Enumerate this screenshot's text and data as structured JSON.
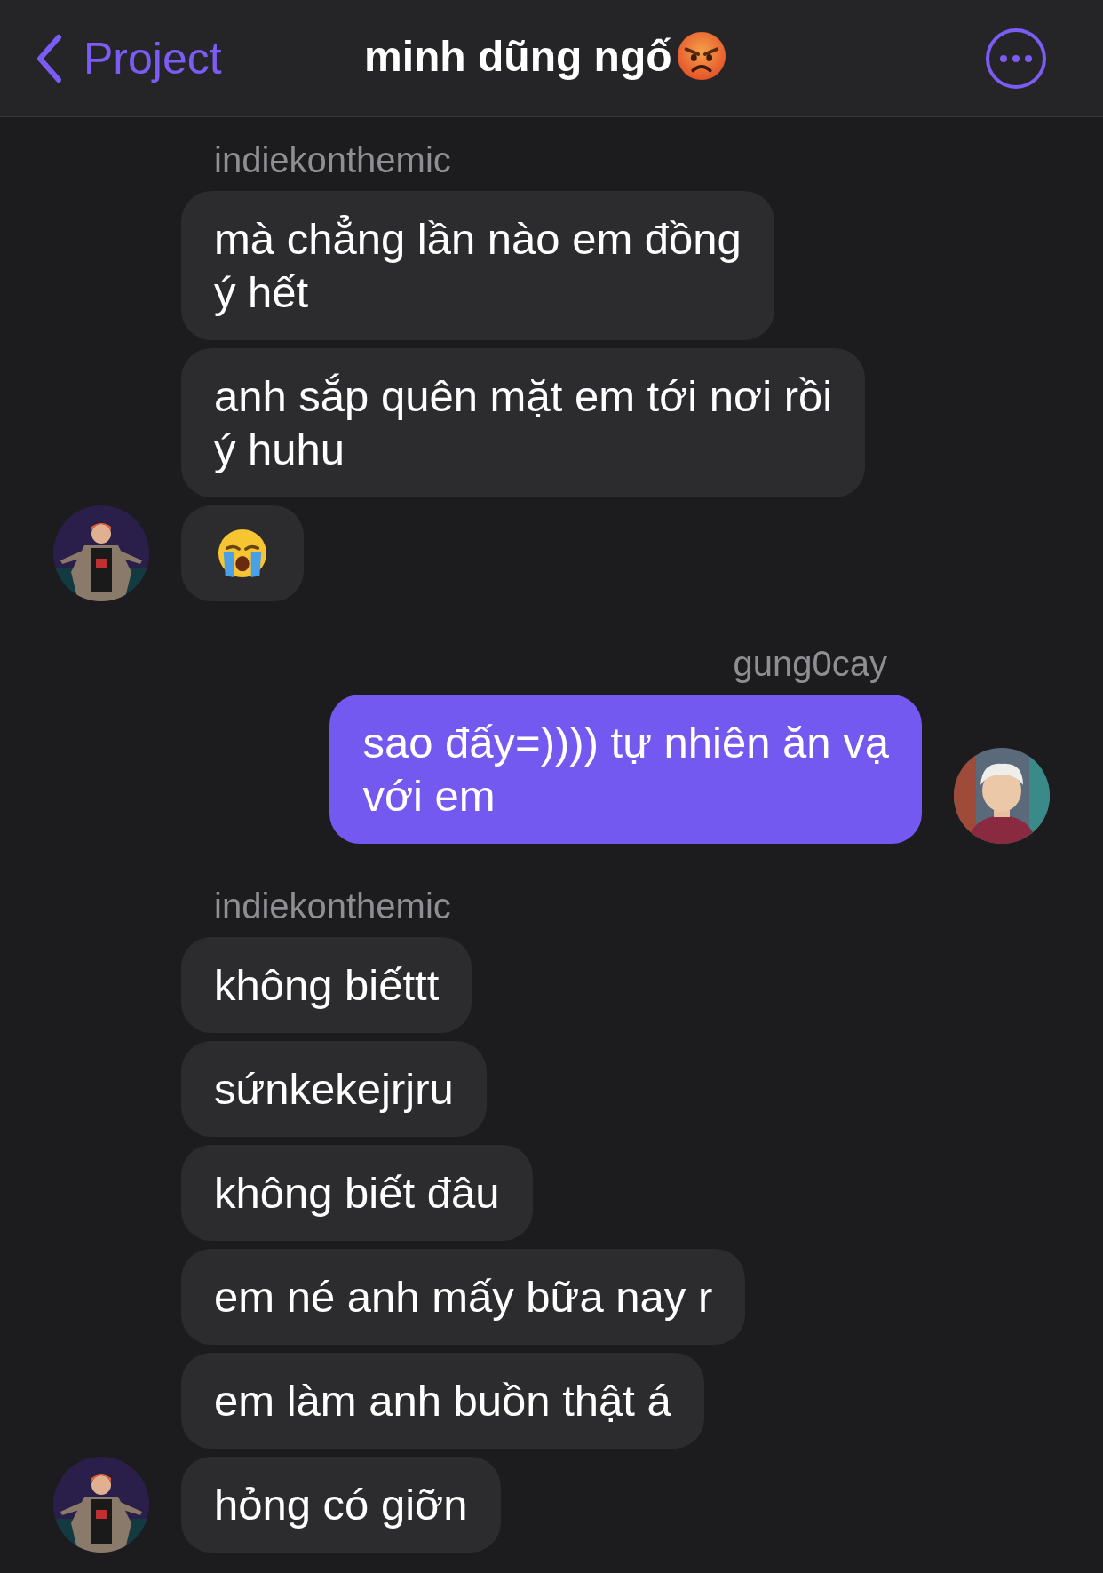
{
  "header": {
    "back_label": "Project",
    "title": "minh dũng ngố"
  },
  "groups": [
    {
      "sender": "indiekonthemic",
      "kind": "incoming",
      "bubbles": [
        {
          "kind": "text",
          "text": "mà chẳng lần nào em đồng\ný hết"
        },
        {
          "kind": "text",
          "text": "anh sắp quên mặt em tới nơi rồi\ný huhu"
        },
        {
          "kind": "crying-emoji"
        }
      ]
    },
    {
      "sender": "gung0cay",
      "kind": "outgoing",
      "bubbles": [
        {
          "kind": "text",
          "text": "sao đấy=)))) tự nhiên ăn vạ\nvới em"
        }
      ]
    },
    {
      "sender": "indiekonthemic",
      "kind": "incoming",
      "bubbles": [
        {
          "kind": "text",
          "text": "không biếttt"
        },
        {
          "kind": "text",
          "text": "sứnkekejrjru"
        },
        {
          "kind": "text",
          "text": "không biết đâu"
        },
        {
          "kind": "text",
          "text": "em né anh mấy bữa nay r"
        },
        {
          "kind": "text",
          "text": "em làm anh buồn thật á"
        },
        {
          "kind": "text",
          "text": "hỏng có giỡn"
        }
      ]
    }
  ]
}
